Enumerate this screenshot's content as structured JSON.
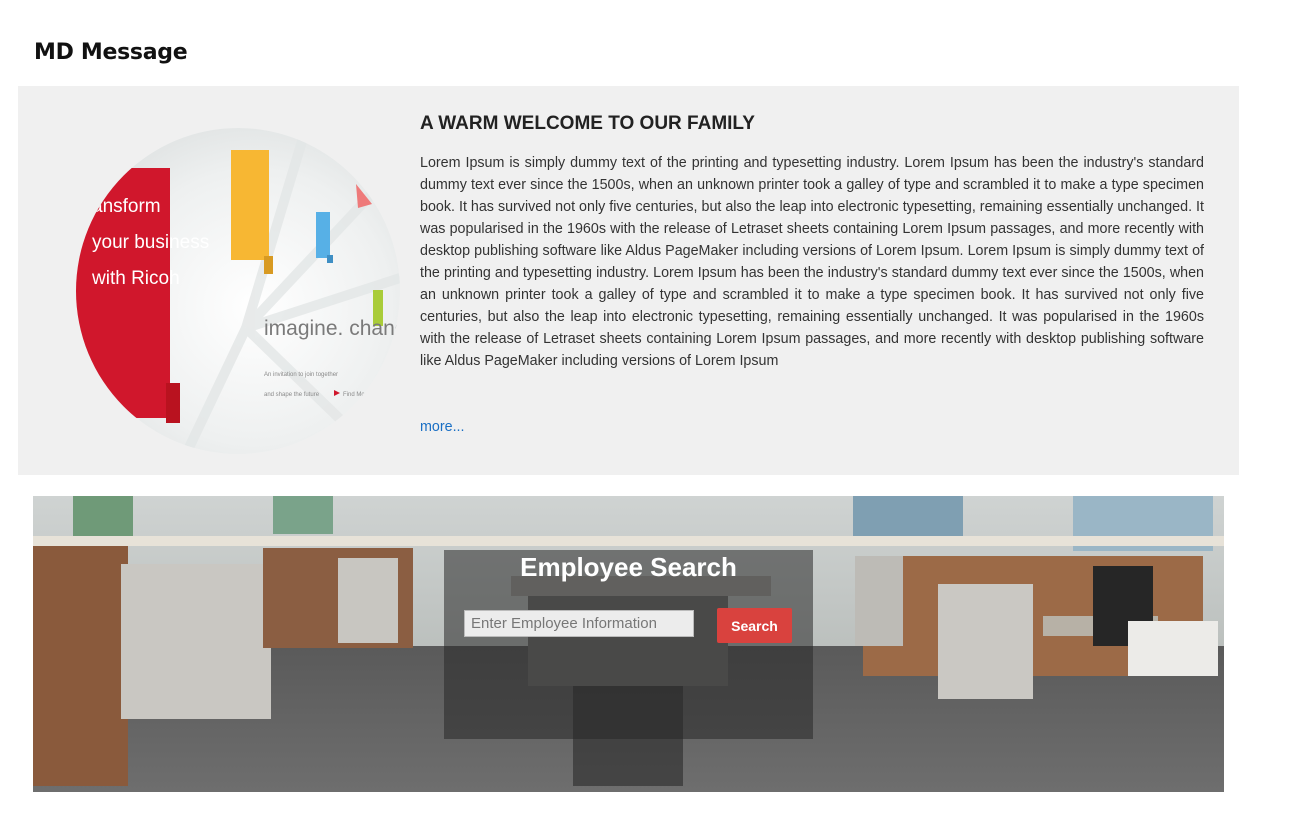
{
  "md_message": {
    "section_title": "MD Message",
    "heading": "A WARM WELCOME TO OUR FAMILY",
    "body": "Lorem Ipsum is simply dummy text of the printing and typesetting industry. Lorem Ipsum has been the industry's standard dummy text ever since the 1500s, when an unknown printer took a galley of type and scrambled it to make a type specimen book. It has survived not only five centuries, but also the leap into electronic typesetting, remaining essentially unchanged. It was popularised in the 1960s with the release of Letraset sheets containing Lorem Ipsum passages, and more recently with desktop publishing software like Aldus PageMaker including versions of Lorem Ipsum. Lorem Ipsum is simply dummy text of the printing and typesetting industry. Lorem Ipsum has been the industry's standard dummy text ever since the 1500s, when an unknown printer took a galley of type and scrambled it to make a type specimen book. It has survived not only five centuries, but also the leap into electronic typesetting, remaining essentially unchanged. It was popularised in the 1960s with the release of Letraset sheets containing Lorem Ipsum passages, and more recently with desktop publishing software like Aldus PageMaker including versions of Lorem Ipsum",
    "more_link": "more...",
    "image": {
      "headline_lines": [
        "ansform",
        "your business",
        "with Ricoh"
      ],
      "tagline": "imagine. change.",
      "small_text_lines": [
        "An invitation to join together",
        "and shape the future"
      ],
      "small_cta": "Find More"
    }
  },
  "employee_search": {
    "title": "Employee Search",
    "input_placeholder": "Enter Employee Information",
    "button_label": "Search"
  },
  "colors": {
    "card_background": "#f0f0f0",
    "link_blue": "#1a6fc4",
    "search_red": "#d9423e",
    "ricoh_red": "#d0172c"
  }
}
